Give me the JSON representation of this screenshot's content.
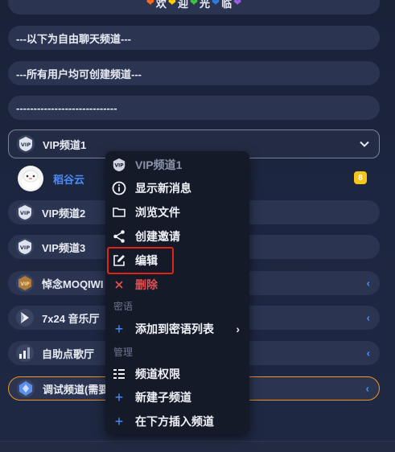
{
  "banner": {
    "text1": "欢",
    "text2": "迎",
    "text3": "光",
    "text4": "临"
  },
  "channels": [
    {
      "label": "---以下为自由聊天频道---"
    },
    {
      "label": "---所有用户均可创建频道---"
    },
    {
      "label": "-----------------------------"
    },
    {
      "label": "VIP频道1"
    },
    {
      "label": "VIP频道2"
    },
    {
      "label": "VIP频道3"
    },
    {
      "label": "悼念MOQIWI"
    },
    {
      "label": "7x24 音乐厅"
    },
    {
      "label": "自助点歌厅"
    },
    {
      "label": "调试频道(需要"
    }
  ],
  "user": {
    "name": "稻谷云",
    "badge": "8"
  },
  "menu": {
    "header": "VIP频道1",
    "items": {
      "show_new": "显示新消息",
      "browse_files": "浏览文件",
      "create_invite": "创建邀请",
      "edit": "编辑",
      "delete": "删除",
      "add_whisper": "添加到密语列表",
      "permissions": "频道权限",
      "new_sub": "新建子频道",
      "insert_below": "在下方插入频道"
    },
    "sections": {
      "whisper": "密语",
      "manage": "管理"
    }
  },
  "colors": {
    "accent": "#4a90ff",
    "highlight": "#e0241c",
    "delete": "#e05050",
    "orange_border": "#f0961e"
  }
}
